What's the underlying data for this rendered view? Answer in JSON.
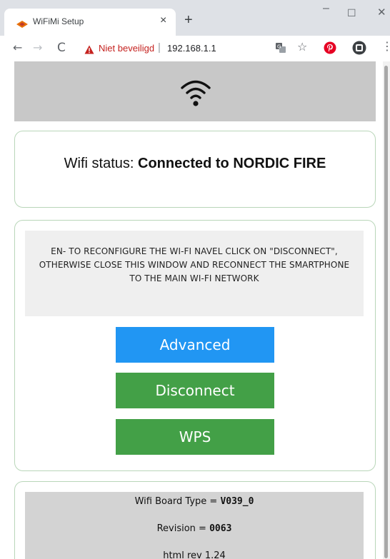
{
  "browser": {
    "tab_title": "WiFiMi Setup",
    "tab_close": "×",
    "new_tab": "+",
    "window_minimize": "–",
    "window_maximize": "☐",
    "window_close": "✕",
    "nav_back": "←",
    "nav_forward": "→",
    "nav_reload": "C",
    "security_label": "Niet beveiligd",
    "url_separator": "|",
    "url": "192.168.1.1",
    "bookmark_star": "☆",
    "menu_dots": "⋮",
    "icons": [
      "wifimi-favicon",
      "translate-icon",
      "star-icon",
      "pinterest-icon",
      "extension-icon",
      "menu-icon"
    ],
    "security_color": "#c5221f"
  },
  "page": {
    "header": {
      "logo_icon": "wifi-icon",
      "background": "#c8c8c8"
    },
    "status": {
      "label": "Wifi status:",
      "value": "Connected to NORDIC FIRE"
    },
    "config": {
      "notice": "EN- TO RECONFIGURE THE WI-FI NAVEL CLICK ON \"DISCONNECT\", OTHERWISE CLOSE THIS WINDOW AND RECONNECT THE SMARTPHONE TO THE MAIN WI-FI NETWORK",
      "buttons": {
        "advanced": "Advanced",
        "disconnect": "Disconnect",
        "wps": "WPS"
      },
      "colors": {
        "advanced": "#2196f3",
        "disconnect": "#43a047",
        "wps": "#43a047"
      }
    },
    "info": {
      "board_label": "Wifi Board Type =",
      "board_value": "V039_0",
      "revision_label": "Revision =",
      "revision_value": "0063",
      "html_rev": "html rev 1.24"
    }
  }
}
